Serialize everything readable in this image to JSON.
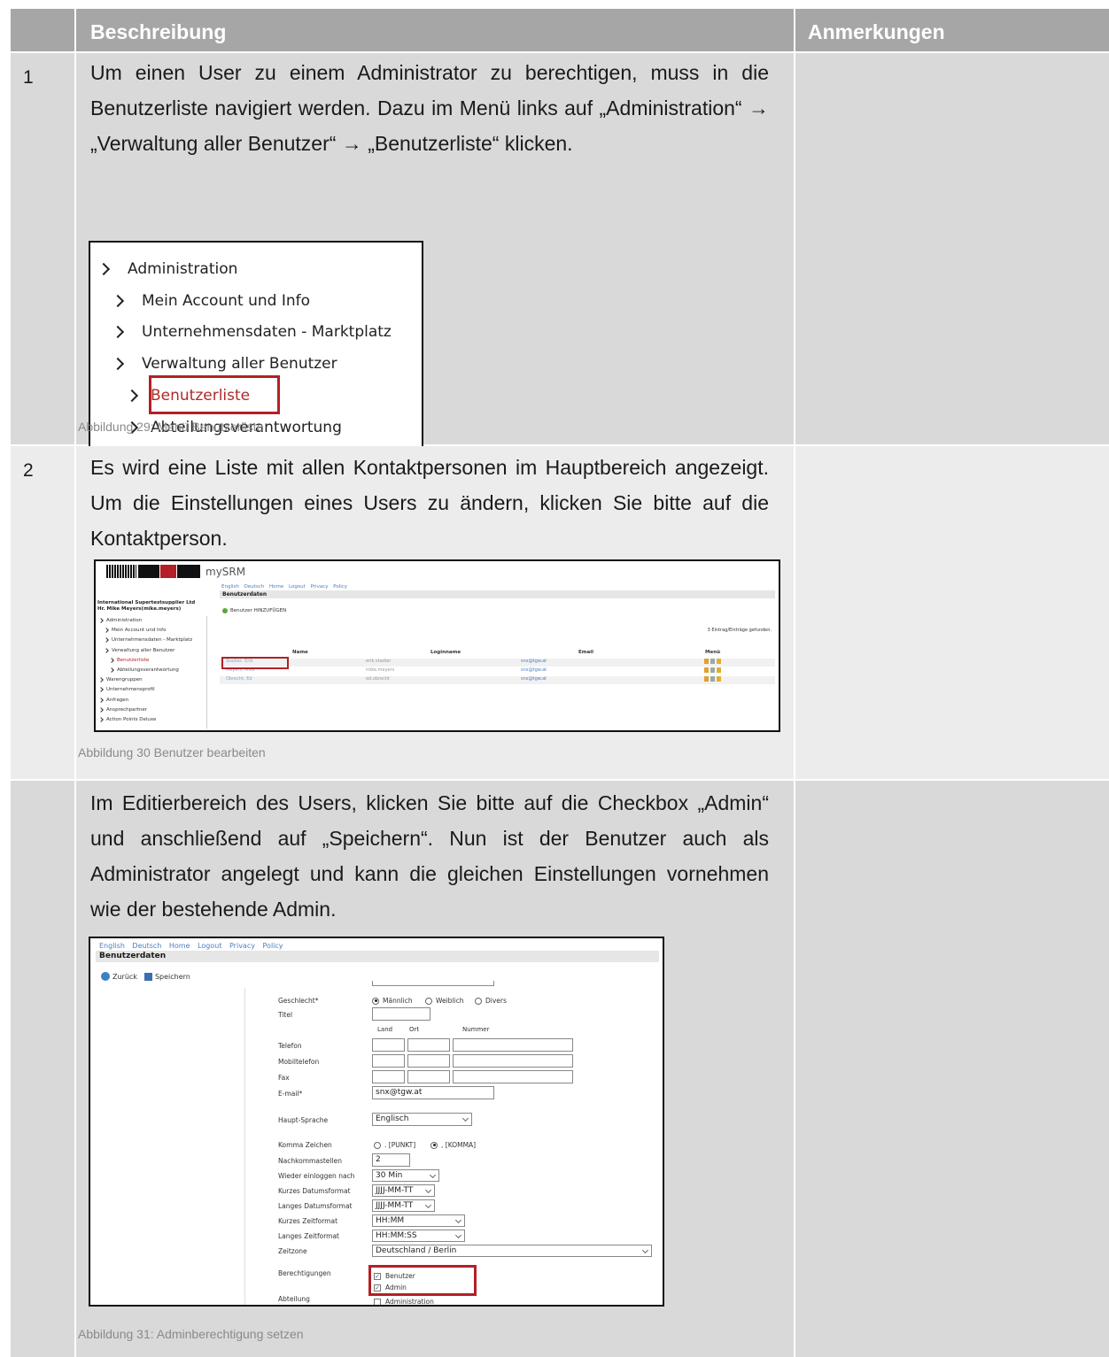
{
  "table": {
    "header": {
      "beschreibung": "Beschreibung",
      "anmerkungen": "Anmerkungen"
    },
    "rows": [
      {
        "number": "1",
        "text": "Um einen User zu einem Administrator zu berechtigen, muss in die Benutzerliste navigiert werden. Dazu im Menü links auf „Administration“ → „Verwaltung aller Benutzer“ → „Benutzerliste“ klicken.",
        "caption": "Abbildung 29: Menü Benutzerliste"
      },
      {
        "number": "2",
        "text": "Es wird eine Liste mit allen Kontaktpersonen im Hauptbereich angezeigt. Um die Einstellungen eines Users zu ändern, klicken Sie bitte auf die Kontaktperson.",
        "caption": "Abbildung 30 Benutzer bearbeiten"
      },
      {
        "number": "",
        "text": "Im Editierbereich des Users, klicken Sie bitte auf die Checkbox „Admin“ und anschließend auf „Speichern“. Nun ist der Benutzer auch als Administrator angelegt und kann die gleichen Einstellungen vornehmen wie der bestehende Admin.",
        "caption": "Abbildung 31: Adminberechtigung setzen"
      }
    ]
  },
  "figure_menu": {
    "items": [
      "Administration",
      "Mein Account und Info",
      "Unternehmensdaten - Marktplatz",
      "Verwaltung aller Benutzer",
      "Benutzerliste",
      "Abteilungsverantwortung"
    ]
  },
  "figure_list": {
    "logo_text": "mySRM",
    "nav": "English  Deutsch    Home  Logout  Privacy Policy",
    "section": "Benutzerdaten",
    "company_line1": "International Supertestsupplier Ltd",
    "company_line2": "Hr. Mike Meyers(mike.meyers)",
    "add_button": "Benutzer HINZUFÜGEN",
    "found": "3 Eintrag/Einträge gefunden.",
    "columns": [
      "Name",
      "Loginname",
      "Email",
      "Menü"
    ],
    "rows": [
      {
        "name": "Stadler, Erik",
        "login": "erik.stadler",
        "email": "snx@tgw.at"
      },
      {
        "name": "Meyers, Mike",
        "login": "mike.meyers",
        "email": "snx@tgw.at"
      },
      {
        "name": "Obrecht, Ed",
        "login": "ed.obrecht",
        "email": "snx@tgw.at"
      }
    ],
    "menu": [
      "Administration",
      "Mein Account und Info",
      "Unternehmensdaten - Marktplatz",
      "Verwaltung aller Benutzer",
      "Benutzerliste",
      "Abteilungsverantwortung",
      "Warengruppen",
      "Unternehmensprofil",
      "Anfragen",
      "Ansprechpartner",
      "Action Points Deluxe"
    ]
  },
  "figure_edit": {
    "nav": "English  Deutsch    Home  Logout  Privacy Policy",
    "section": "Benutzerdaten",
    "back": "Zurück",
    "save": "Speichern",
    "labels": {
      "gender": "Geschlecht*",
      "title": "Titel",
      "phone": "Telefon",
      "mobile": "Mobiltelefon",
      "fax": "Fax",
      "email": "E-mail*",
      "language": "Haupt-Sprache",
      "comma": "Komma Zeichen",
      "decimals": "Nachkommastellen",
      "relogin": "Wieder einloggen nach",
      "short_date": "Kurzes Datumsformat",
      "long_date": "Langes Datumsformat",
      "short_time": "Kurzes Zeitformat",
      "long_time": "Langes Zeitformat",
      "timezone": "Zeitzone",
      "permissions": "Berechtigungen",
      "department": "Abteilung"
    },
    "gender_options": [
      "Männlich",
      "Weiblich",
      "Divers"
    ],
    "phone_cols": [
      "Land",
      "Ort",
      "Nummer"
    ],
    "values": {
      "email": "snx@tgw.at",
      "language": "Englisch",
      "comma_punkt": ". [PUNKT]",
      "comma_komma": ", [KOMMA]",
      "decimals": "2",
      "relogin": "30 Min",
      "short_date": "JJJJ-MM-TT",
      "long_date": "JJJJ-MM-TT",
      "short_time": "HH:MM",
      "long_time": "HH:MM:SS",
      "timezone": "Deutschland / Berlin"
    },
    "permissions": [
      "Benutzer",
      "Admin"
    ],
    "department": "Administration"
  }
}
